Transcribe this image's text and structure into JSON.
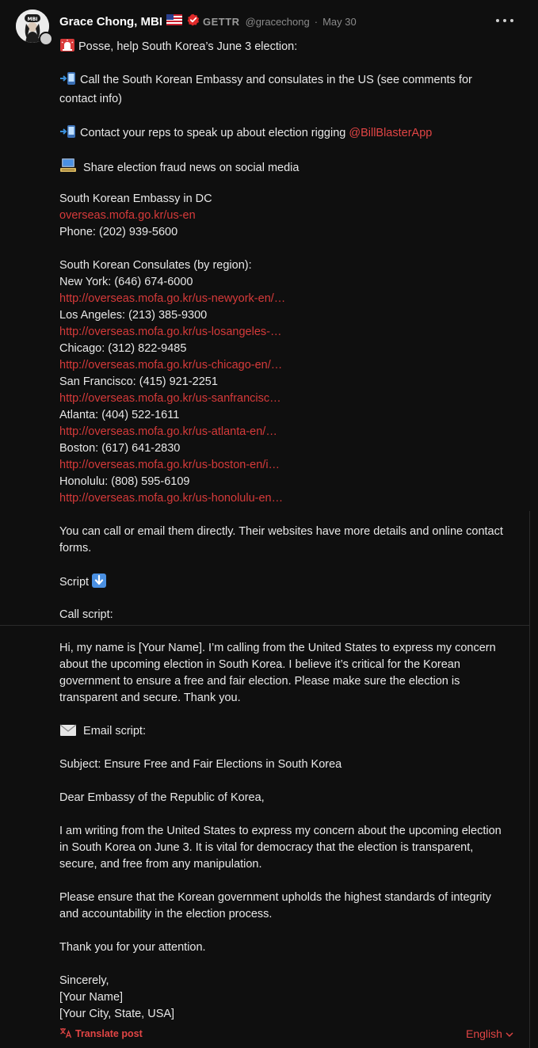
{
  "post": {
    "author": {
      "display_name": "Grace Chong, MBI",
      "platform_label": "GETTR",
      "handle": "@gracechong",
      "date": "May 30",
      "avatar_text": "MBI"
    },
    "icons": {
      "flag": "us-flag-icon",
      "verified": "verified-badge-icon",
      "more": "more-options-icon",
      "siren": "siren-icon",
      "phone": "mobile-phone-arrow-icon",
      "computer": "computer-icon",
      "down": "down-arrow-icon",
      "envelope": "envelope-icon",
      "translate": "translate-icon",
      "chevron": "chevron-down-icon"
    },
    "body": {
      "intro": "Posse, help South Korea’s June 3 election:",
      "step1": "Call the South Korean Embassy and consulates in the US (see comments for contact info)",
      "step2": "Contact your reps to speak up about election rigging ",
      "step2_mention": "@BillBlasterApp",
      "step3": " Share election fraud news on social media",
      "embassy_title": "South Korean Embassy in DC",
      "embassy_link": "overseas.mofa.go.kr/us-en",
      "embassy_phone": "Phone: (202) 939-5600",
      "consulates_title": "South Korean Consulates (by region):",
      "consulates": [
        {
          "line": "New York: (646) 674-6000",
          "link": "http://overseas.mofa.go.kr/us-newyork-en/…"
        },
        {
          "line": "Los Angeles: (213) 385-9300",
          "link": "http://overseas.mofa.go.kr/us-losangeles-…"
        },
        {
          "line": "Chicago: (312) 822-9485",
          "link": "http://overseas.mofa.go.kr/us-chicago-en/…"
        },
        {
          "line": "San Francisco: (415) 921-2251",
          "link": "http://overseas.mofa.go.kr/us-sanfrancisc…"
        },
        {
          "line": "Atlanta: (404) 522-1611",
          "link": "http://overseas.mofa.go.kr/us-atlanta-en/…"
        },
        {
          "line": "Boston: (617) 641-2830",
          "link": "http://overseas.mofa.go.kr/us-boston-en/i…"
        },
        {
          "line": "Honolulu: (808) 595-6109",
          "link": "http://overseas.mofa.go.kr/us-honolulu-en…"
        }
      ],
      "call_note": "You can call or email them directly. Their websites have more details and online contact forms.",
      "script_label": "Script ",
      "call_script_label": " Call script:",
      "call_script": "Hi, my name is [Your Name]. I’m calling from the United States to express my concern about the upcoming election in South Korea. I believe it’s critical for the Korean government to ensure a free and fair election. Please make sure the election is transparent and secure. Thank you.",
      "email_script_label": " Email script:",
      "subject": "Subject: Ensure Free and Fair Elections in South Korea",
      "salutation": "Dear Embassy of the Republic of Korea,",
      "para1": "I am writing from the United States to express my concern about the upcoming election in South Korea on June 3. It is vital for democracy that the election is transparent, secure, and free from any manipulation.",
      "para2": "Please ensure that the Korean government upholds the highest standards of integrity and accountability in the election process.",
      "thanks": "Thank you for your attention.",
      "signoff": "Sincerely,",
      "sig_name": "[Your Name]",
      "sig_city": "[Your City, State, USA]"
    },
    "footer": {
      "translate_label": "Translate post",
      "language": "English"
    }
  }
}
